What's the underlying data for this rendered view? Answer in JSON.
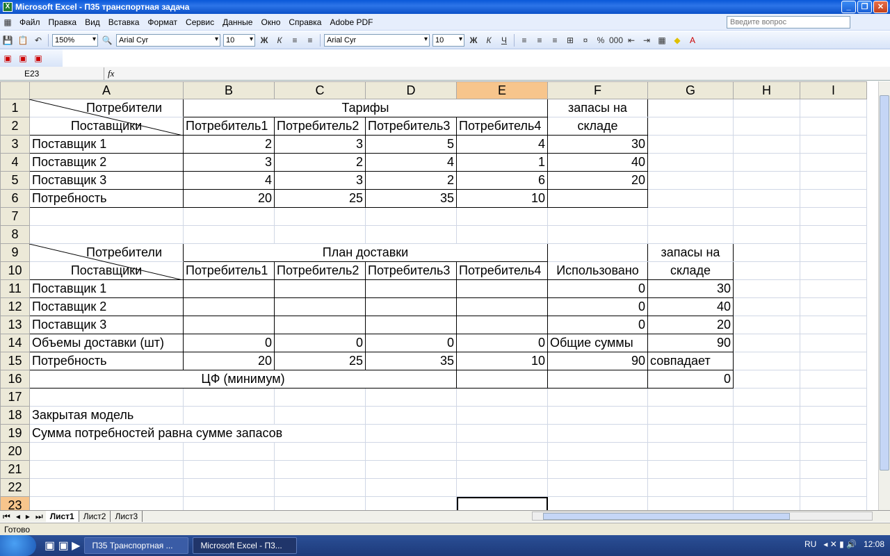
{
  "window": {
    "title": "Microsoft Excel - П35 транспортная задача"
  },
  "menu": [
    "Файл",
    "Правка",
    "Вид",
    "Вставка",
    "Формат",
    "Сервис",
    "Данные",
    "Окно",
    "Справка",
    "Adobe PDF"
  ],
  "ask_placeholder": "Введите вопрос",
  "toolbar": {
    "zoom": "150%",
    "font": "Arial Cyr",
    "size": "10",
    "font2": "Arial Cyr",
    "size2": "10",
    "bold": "Ж",
    "italic": "К",
    "underline": "Ч"
  },
  "formula": {
    "cell": "E23",
    "fx": "fx"
  },
  "columns": [
    "A",
    "B",
    "C",
    "D",
    "E",
    "F",
    "G",
    "H",
    "I"
  ],
  "table1": {
    "corner_top": "Потребители",
    "corner_bottom": "Поставщики",
    "tariffs": "Тарифы",
    "stock_top": "запасы на",
    "stock_bottom": "складе",
    "consumers": [
      "Потребитель1",
      "Потребитель2",
      "Потребитель3",
      "Потребитель4"
    ],
    "rows": [
      {
        "name": "Поставщик 1",
        "vals": [
          "2",
          "3",
          "5",
          "4"
        ],
        "stock": "30"
      },
      {
        "name": "Поставщик 2",
        "vals": [
          "3",
          "2",
          "4",
          "1"
        ],
        "stock": "40"
      },
      {
        "name": "Поставщик 3",
        "vals": [
          "4",
          "3",
          "2",
          "6"
        ],
        "stock": "20"
      }
    ],
    "need_label": "Потребность",
    "need": [
      "20",
      "25",
      "35",
      "10"
    ]
  },
  "table2": {
    "corner_top": "Потребители",
    "corner_bottom": "Поставщики",
    "plan": "План доставки",
    "used": "Использовано",
    "stock_top": "запасы на",
    "stock_bottom": "складе",
    "consumers": [
      "Потребитель1",
      "Потребитель2",
      "Потребитель3",
      "Потребитель4"
    ],
    "rows": [
      {
        "name": "Поставщик 1",
        "used": "0",
        "stock": "30"
      },
      {
        "name": "Поставщик 2",
        "used": "0",
        "stock": "40"
      },
      {
        "name": "Поставщик 3",
        "used": "0",
        "stock": "20"
      }
    ],
    "volume_label": "Объемы доставки (шт)",
    "volumes": [
      "0",
      "0",
      "0",
      "0"
    ],
    "totals_label": "Общие суммы",
    "totals": "90",
    "need_label": "Потребность",
    "need": [
      "20",
      "25",
      "35",
      "10"
    ],
    "need_sum": "90",
    "match": "совпадает",
    "obj_label": "ЦФ (минимум)",
    "obj": "0"
  },
  "notes": [
    "Закрытая модель",
    "Сумма потребностей равна сумме запасов"
  ],
  "sheets": [
    "Лист1",
    "Лист2",
    "Лист3"
  ],
  "status": "Готово",
  "taskbar": {
    "items": [
      "П35 Транспортная ...",
      "Microsoft Excel - П3..."
    ],
    "lang": "RU",
    "time": "12:08"
  }
}
